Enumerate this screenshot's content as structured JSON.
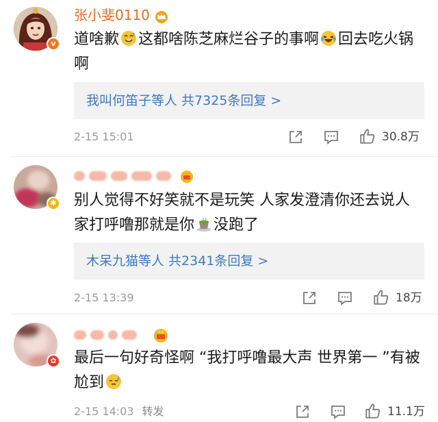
{
  "comments": [
    {
      "username": "张小斐0110",
      "text_part1": "道啥歉",
      "emoji1": "sweat-smile-emoji",
      "text_part2": "这都啥陈芝麻烂谷子的事啊",
      "emoji2": "laughing-tears-emoji",
      "text_part3": "回去吃火锅啊",
      "reply_summary": "我叫何笛子等人 共7325条回复 >",
      "timestamp": "2-15 15:01",
      "like_count": "30.8万",
      "avatar_icon": "woman-avatar",
      "badge_color": "#f07a1d",
      "crown_color": "#f0a51e"
    },
    {
      "username": "",
      "text_part1": "别人觉得不好笑就不是玩笑 人家发澄清你还去说人家打呼噜那就是你",
      "emoji1": "tea-cup-emoji",
      "text_part2": "没跑了",
      "reply_summary": "木呆九猫等人 共2341条回复 >",
      "timestamp": "2-15 13:39",
      "like_count": "18万",
      "avatar_icon": "blurred-avatar",
      "badge_color": "#f2b619"
    },
    {
      "username": "",
      "text_part1": "最后一句好奇怪啊 “我打呼噜最大声 世界第一 ”有被尬到",
      "emoji1": "embarrassed-sweat-emoji",
      "timestamp": "2-15 14:03",
      "repost_label": "转发",
      "like_count": "11.1万",
      "avatar_icon": "blurred-avatar",
      "badge_color": "#e23a2a"
    }
  ],
  "colors": {
    "link": "#3f79c3",
    "username": "#e86b1c",
    "meta": "#9a9a9a",
    "reply_bg": "#f2f2f2"
  },
  "icons": [
    "share-icon",
    "comment-icon",
    "like-icon"
  ]
}
